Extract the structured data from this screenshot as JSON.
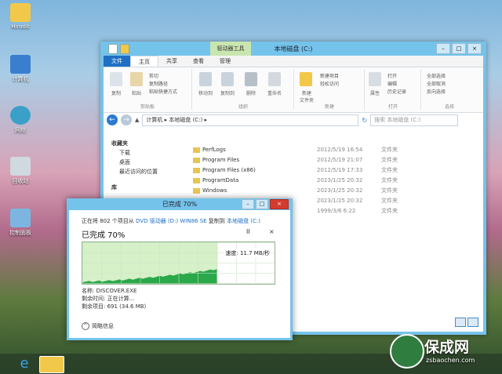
{
  "desktop": {
    "icons": [
      {
        "label": "Hirodit"
      },
      {
        "label": "计算机"
      },
      {
        "label": "网络"
      },
      {
        "label": "回收站"
      },
      {
        "label": "控制面板"
      }
    ]
  },
  "explorer": {
    "title": "本地磁盘 (C:)",
    "context_tab": "驱动器工具",
    "tabs": [
      "文件",
      "主页",
      "共享",
      "查看",
      "管理"
    ],
    "ribbon": {
      "groups": [
        "剪贴板",
        "组织",
        "新建",
        "打开",
        "选择"
      ],
      "clipboard": {
        "copy": "复制",
        "paste": "粘贴",
        "cut": "剪切",
        "copy_path": "复制路径",
        "paste_shortcut": "粘贴快捷方式"
      },
      "organize": {
        "move_to": "移动到",
        "copy_to": "复制到",
        "delete": "删除",
        "rename": "重命名"
      },
      "new": {
        "new_folder": "新建\n文件夹",
        "new_item": "新建项目",
        "easy_access": "轻松访问"
      },
      "open": {
        "properties": "属性",
        "open": "打开",
        "edit": "编辑",
        "history": "历史记录"
      },
      "select": {
        "select_all": "全部选择",
        "select_none": "全部取消",
        "invert": "反向选择"
      }
    },
    "address": {
      "path": "计算机 ▸ 本地磁盘 (C:) ▸",
      "search_placeholder": "搜索 本地磁盘 (C:)"
    },
    "nav": {
      "items": [
        "收藏夹",
        "下载",
        "桌面",
        "最近访问的位置",
        "库"
      ]
    },
    "files": [
      {
        "name": "PerfLogs",
        "date": "2012/5/19 16:54",
        "type": "文件夹"
      },
      {
        "name": "Program Files",
        "date": "2012/5/19 21:07",
        "type": "文件夹"
      },
      {
        "name": "Program Files (x86)",
        "date": "2012/5/19 17:33",
        "type": "文件夹"
      },
      {
        "name": "ProgramData",
        "date": "2023/1/25 20:32",
        "type": "文件夹"
      },
      {
        "name": "Windows",
        "date": "2023/1/25 20:32",
        "type": "文件夹"
      },
      {
        "name": "",
        "date": "2023/1/25 20:32",
        "type": "文件夹"
      },
      {
        "name": "",
        "date": "1999/3/6 6:22",
        "type": "文件夹"
      }
    ]
  },
  "copy_dialog": {
    "title": "已完成 70%",
    "line_prefix": "正在将 802 个项目从",
    "source": "DVD 驱动器 (D:) WIN86 SE",
    "line_mid": "复制到",
    "dest": "本地磁盘 (C:)",
    "percent_text": "已完成 70%",
    "progress": 0.7,
    "pause": "II",
    "cancel": "×",
    "speed": "速度: 11.7 MB/秒",
    "name_line": "名称: DISCOVER.EXE",
    "time_line": "剩余时间: 正在计算...",
    "items_line": "剩余项目: 691 (34.6 MB)",
    "more_info": "简略信息"
  },
  "watermark": {
    "text": "保成网",
    "url": "zsbaochen.com"
  }
}
